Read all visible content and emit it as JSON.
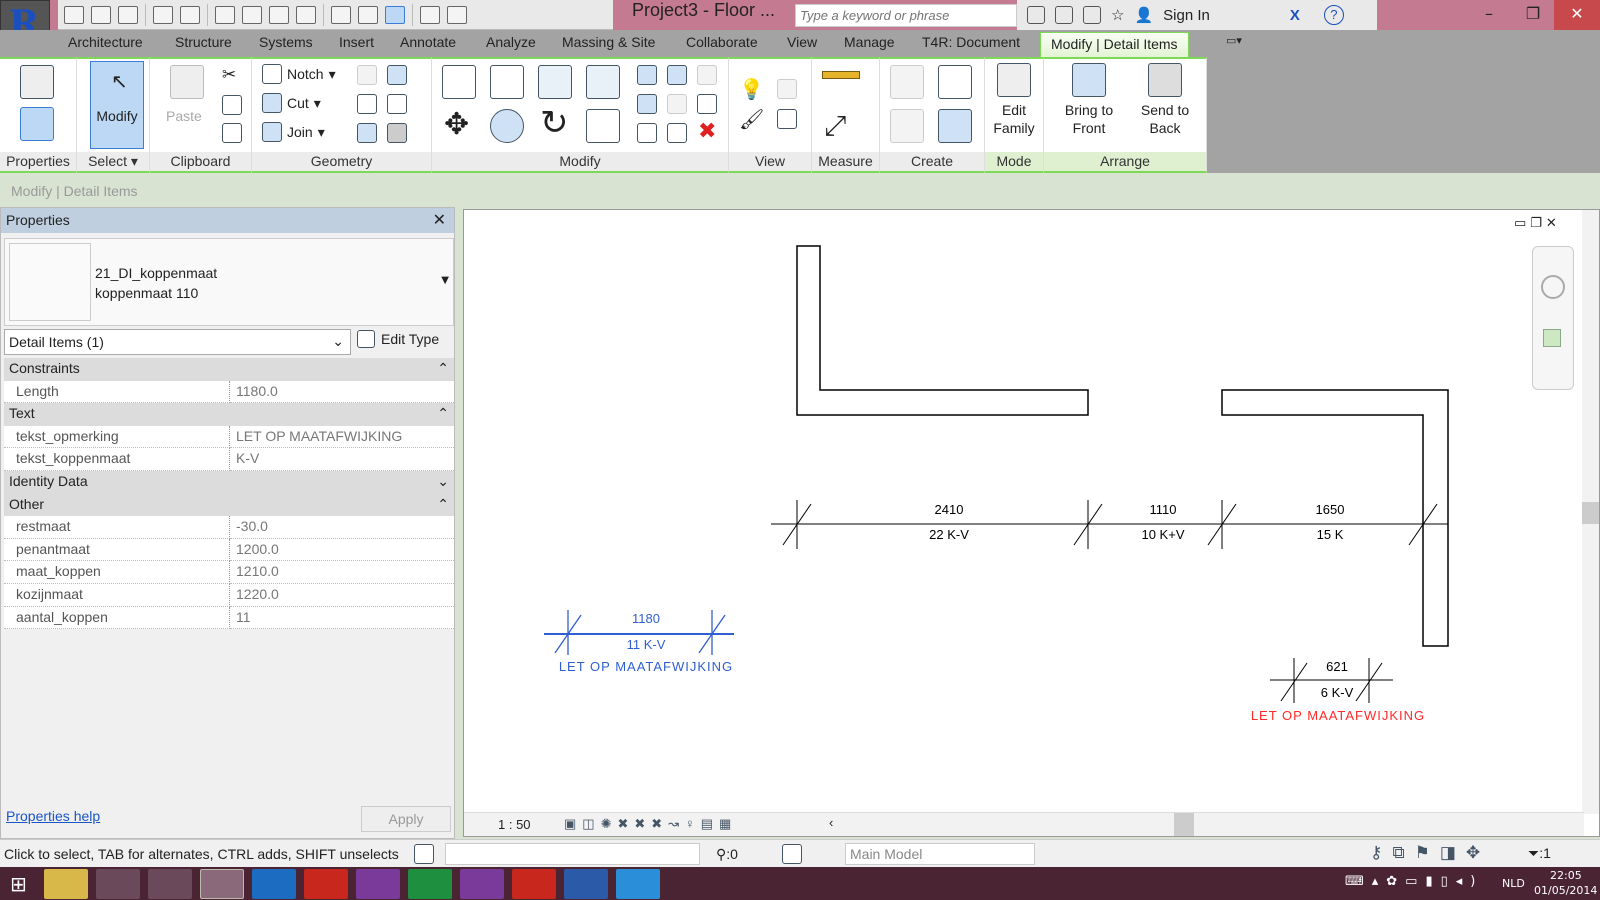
{
  "app": {
    "title": "Project3 - Floor ...",
    "search_placeholder": "Type a keyword or phrase",
    "sign_in": "Sign In",
    "accent": "#7ed957",
    "titlebar_color": "#c47a90"
  },
  "tabs": [
    "Architecture",
    "Structure",
    "Systems",
    "Insert",
    "Annotate",
    "Analyze",
    "Massing & Site",
    "Collaborate",
    "View",
    "Manage",
    "T4R: Document",
    "Modify | Detail Items"
  ],
  "ribbon": {
    "panels": [
      "Properties",
      "Select",
      "Clipboard",
      "Geometry",
      "Modify",
      "View",
      "Measure",
      "Create",
      "Mode",
      "Arrange"
    ],
    "modify": "Modify",
    "paste": "Paste",
    "notch": "Notch",
    "cut": "Cut",
    "join": "Join",
    "edit_family": [
      "Edit",
      "Family"
    ],
    "bring_front": [
      "Bring to",
      "Front"
    ],
    "send_back": [
      "Send to",
      "Back"
    ]
  },
  "options_bar": "Modify | Detail Items",
  "properties": {
    "title": "Properties",
    "type_family": "21_DI_koppenmaat",
    "type_name": "koppenmaat 110",
    "instance_selector": "Detail Items (1)",
    "edit_type": "Edit Type",
    "groups": [
      {
        "name": "Constraints",
        "rows": [
          [
            "Length",
            "1180.0"
          ]
        ]
      },
      {
        "name": "Text",
        "rows": [
          [
            "tekst_opmerking",
            "LET OP MAATAFWIJKING"
          ],
          [
            "tekst_koppenmaat",
            "K-V"
          ]
        ]
      },
      {
        "name": "Identity Data",
        "rows": []
      },
      {
        "name": "Other",
        "rows": [
          [
            "restmaat",
            "-30.0"
          ],
          [
            "penantmaat",
            "1200.0"
          ],
          [
            "maat_koppen",
            "1210.0"
          ],
          [
            "kozijnmaat",
            "1220.0"
          ],
          [
            "aantal_koppen",
            "11"
          ]
        ]
      }
    ],
    "help": "Properties help",
    "apply": "Apply"
  },
  "drawing": {
    "dims": [
      {
        "top": "2410",
        "bottom": "22 K-V"
      },
      {
        "top": "1110",
        "bottom": "10 K+V"
      },
      {
        "top": "1650",
        "bottom": "15 K"
      }
    ],
    "selected": {
      "top": "1180",
      "bottom": "11 K-V",
      "note": "LET OP MAATAFWIJKING",
      "color": "#2f5fd0"
    },
    "other": {
      "top": "621",
      "bottom": "6 K-V",
      "note": "LET OP MAATAFWIJKING",
      "note_color": "#ff2a2a"
    }
  },
  "view_bar": {
    "scale": "1 : 50"
  },
  "status": {
    "hint": "Click to select, TAB for alternates, CTRL adds, SHIFT unselects",
    "count": ":0",
    "model": "Main Model",
    "filter": ":1"
  },
  "taskbar": {
    "lang": "NLD",
    "time": "22:05",
    "date": "01/05/2014"
  }
}
